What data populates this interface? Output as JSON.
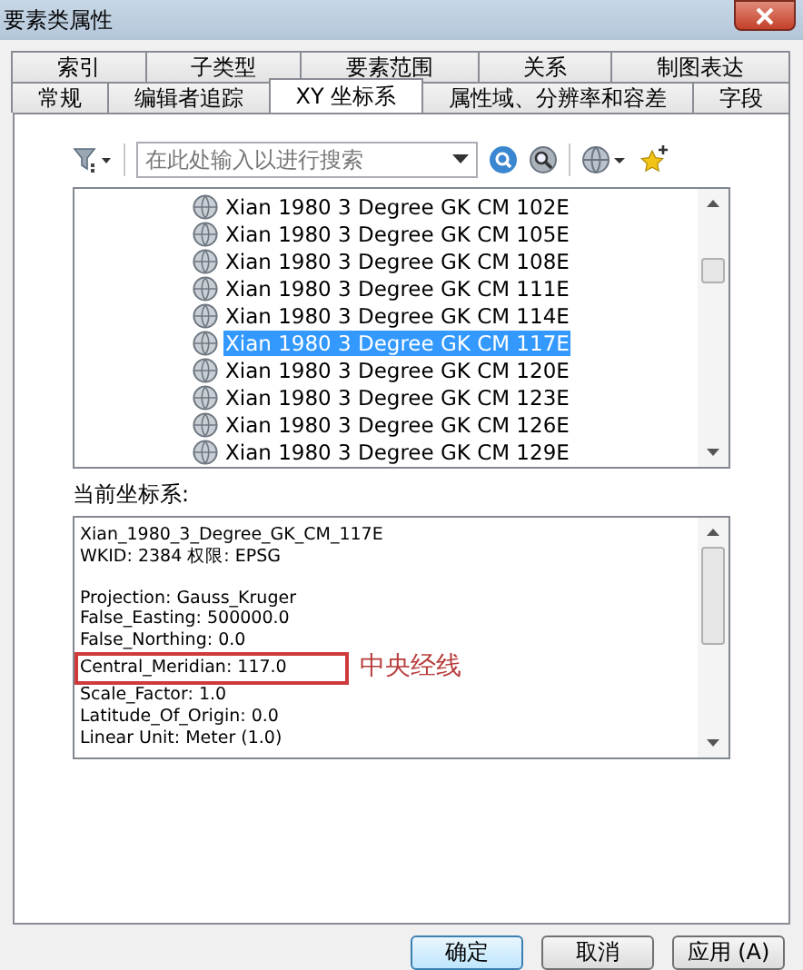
{
  "window": {
    "title": "要素类属性"
  },
  "tab_rows": [
    [
      {
        "label": "索引",
        "selected": false
      },
      {
        "label": "子类型",
        "selected": false
      },
      {
        "label": "要素范围",
        "selected": false
      },
      {
        "label": "关系",
        "selected": false
      },
      {
        "label": "制图表达",
        "selected": false
      }
    ],
    [
      {
        "label": "常规",
        "selected": false
      },
      {
        "label": "编辑者追踪",
        "selected": false
      },
      {
        "label": "XY 坐标系",
        "selected": true
      },
      {
        "label": "属性域、分辨率和容差",
        "selected": false
      },
      {
        "label": "字段",
        "selected": false
      }
    ]
  ],
  "search": {
    "placeholder": "在此处输入以进行搜索"
  },
  "coordinate_systems": [
    {
      "label": "Xian 1980 3 Degree GK CM 102E",
      "selected": false
    },
    {
      "label": "Xian 1980 3 Degree GK CM 105E",
      "selected": false
    },
    {
      "label": "Xian 1980 3 Degree GK CM 108E",
      "selected": false
    },
    {
      "label": "Xian 1980 3 Degree GK CM 111E",
      "selected": false
    },
    {
      "label": "Xian 1980 3 Degree GK CM 114E",
      "selected": false
    },
    {
      "label": "Xian 1980 3 Degree GK CM 117E",
      "selected": true
    },
    {
      "label": "Xian 1980 3 Degree GK CM 120E",
      "selected": false
    },
    {
      "label": "Xian 1980 3 Degree GK CM 123E",
      "selected": false
    },
    {
      "label": "Xian 1980 3 Degree GK CM 126E",
      "selected": false
    },
    {
      "label": "Xian 1980 3 Degree GK CM 129E",
      "selected": false
    }
  ],
  "current_label": "当前坐标系:",
  "details": [
    {
      "lines": [
        {
          "text": "Xian_1980_3_Degree_GK_CM_117E",
          "highlighted": false
        },
        {
          "text": "WKID: 2384 权限: EPSG",
          "highlighted": false
        }
      ]
    },
    {
      "lines": [
        {
          "text": "Projection: Gauss_Kruger",
          "highlighted": false
        },
        {
          "text": "False_Easting: 500000.0",
          "highlighted": false
        },
        {
          "text": "False_Northing: 0.0",
          "highlighted": false
        },
        {
          "text": "Central_Meridian: 117.0",
          "highlighted": true
        },
        {
          "text": "Scale_Factor: 1.0",
          "highlighted": false
        },
        {
          "text": "Latitude_Of_Origin: 0.0",
          "highlighted": false
        },
        {
          "text": "Linear Unit: Meter (1.0)",
          "highlighted": false
        }
      ]
    }
  ],
  "annotation": "中央经线",
  "buttons": [
    {
      "label": "确定",
      "default": true
    },
    {
      "label": "取消",
      "default": false
    },
    {
      "label": "应用 (A)",
      "default": false
    }
  ]
}
